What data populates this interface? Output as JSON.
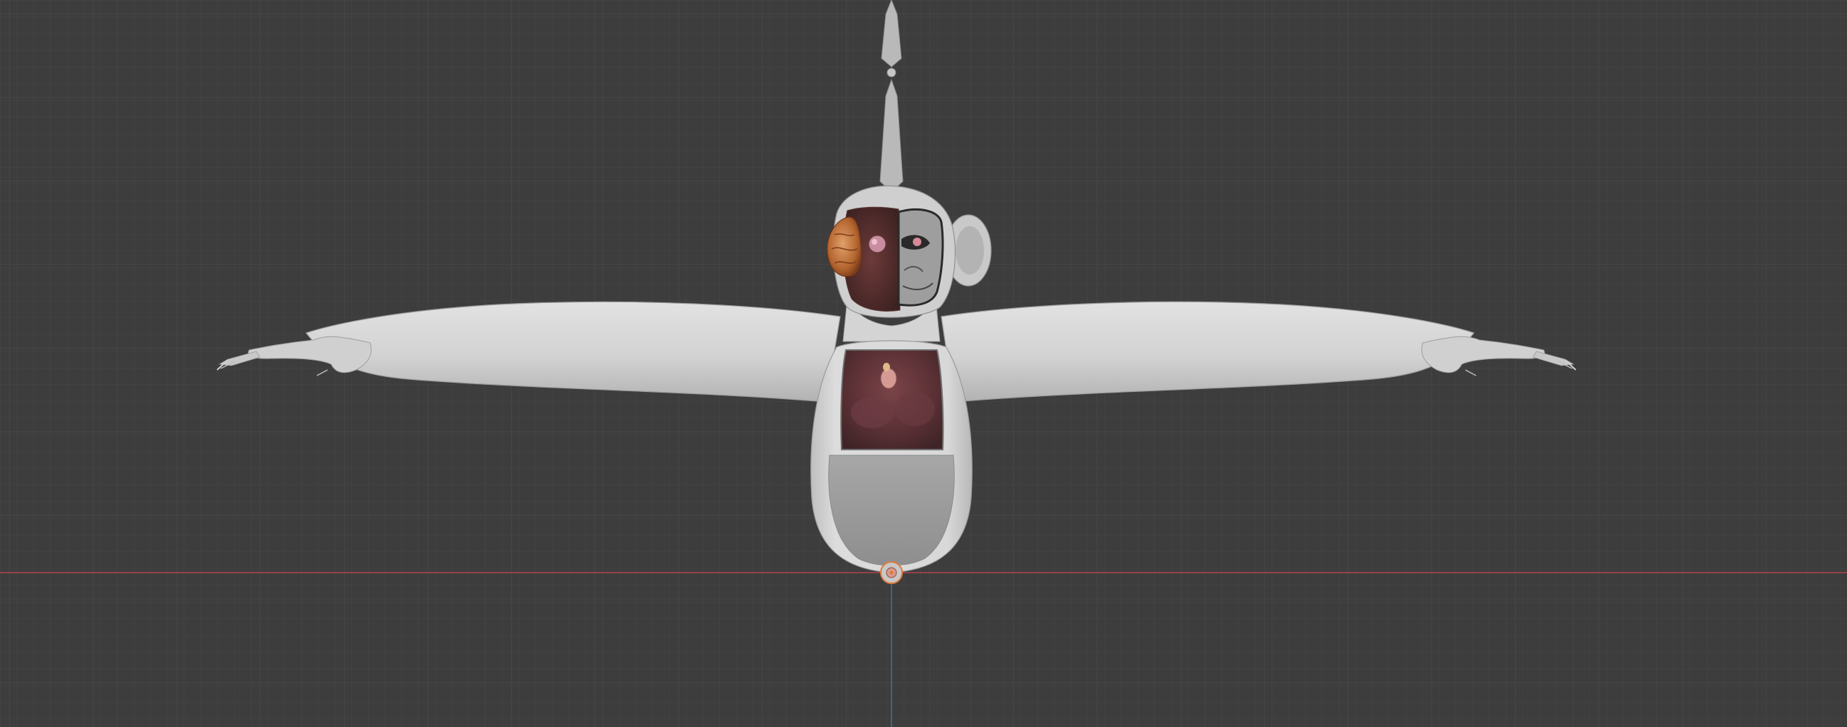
{
  "viewport": {
    "background_color": "#3d3d3d",
    "grid_minor_color": "#464646",
    "grid_major_color": "#4e4e4e",
    "x_axis_color": "#b0454f",
    "z_axis_color": "#3e6f9e"
  },
  "model": {
    "fur_color": "#d7d7d7",
    "fur_shade_color": "#a9a9a9",
    "belly_color": "#9b9b9b",
    "flesh_color": "#5b3236",
    "brain_color": "#c0753c",
    "armature_color": "#b9b9b9"
  },
  "origin_marker": {
    "icon": "object-origin-icon",
    "color": "#e07a3a"
  }
}
